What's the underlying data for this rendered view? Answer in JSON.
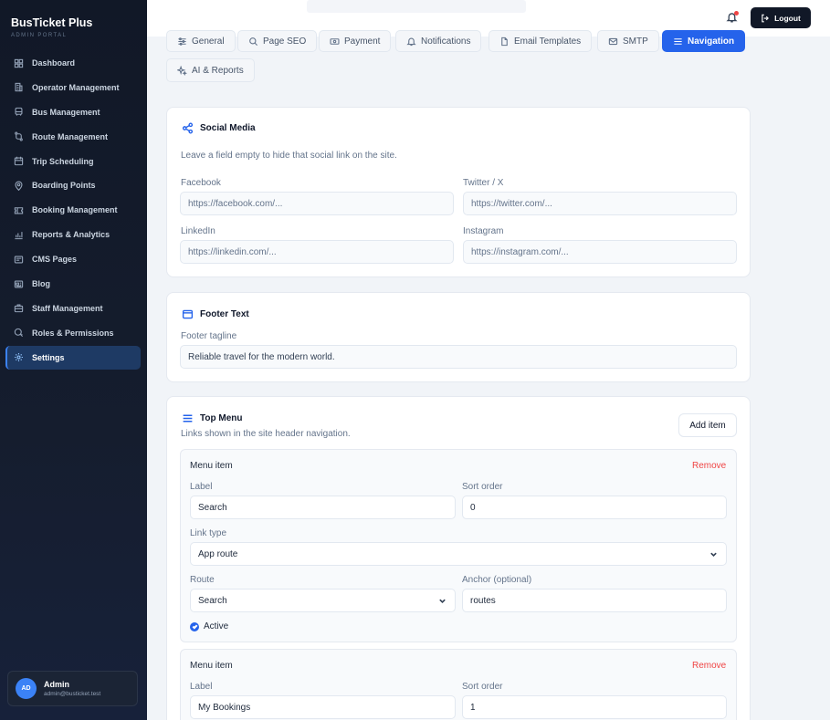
{
  "brand": {
    "title": "BusTicket Plus",
    "subtitle": "ADMIN PORTAL"
  },
  "nav": [
    {
      "label": "Dashboard",
      "icon": "dashboard-icon"
    },
    {
      "label": "Operator Management",
      "icon": "building-icon"
    },
    {
      "label": "Bus Management",
      "icon": "bus-icon"
    },
    {
      "label": "Route Management",
      "icon": "route-icon"
    },
    {
      "label": "Trip Scheduling",
      "icon": "calendar-icon"
    },
    {
      "label": "Boarding Points",
      "icon": "map-pin-icon"
    },
    {
      "label": "Booking Management",
      "icon": "ticket-icon"
    },
    {
      "label": "Reports & Analytics",
      "icon": "chart-icon"
    },
    {
      "label": "CMS Pages",
      "icon": "page-icon"
    },
    {
      "label": "Blog",
      "icon": "newspaper-icon"
    },
    {
      "label": "Staff Management",
      "icon": "briefcase-icon"
    },
    {
      "label": "Roles & Permissions",
      "icon": "shield-icon"
    },
    {
      "label": "Settings",
      "icon": "gear-icon",
      "active": true
    }
  ],
  "user": {
    "initials": "AD",
    "name": "Admin",
    "email": "admin@busticket.test"
  },
  "header": {
    "logout_label": "Logout"
  },
  "tabs": [
    {
      "label": "General",
      "icon": "sliders-icon"
    },
    {
      "label": "Page SEO",
      "icon": "search-icon"
    },
    {
      "label": "Payment",
      "icon": "money-icon"
    },
    {
      "label": "Notifications",
      "icon": "bell-icon"
    },
    {
      "label": "Email Templates",
      "icon": "file-icon"
    },
    {
      "label": "SMTP",
      "icon": "mail-icon"
    },
    {
      "label": "Navigation",
      "icon": "menu-icon",
      "active": true
    },
    {
      "label": "AI & Reports",
      "icon": "sparkle-icon"
    }
  ],
  "social": {
    "title": "Social Media",
    "hint": "Leave a field empty to hide that social link on the site.",
    "facebook": {
      "label": "Facebook",
      "placeholder": "https://facebook.com/..."
    },
    "twitter": {
      "label": "Twitter / X",
      "placeholder": "https://twitter.com/..."
    },
    "linkedin": {
      "label": "LinkedIn",
      "placeholder": "https://linkedin.com/..."
    },
    "instagram": {
      "label": "Instagram",
      "placeholder": "https://instagram.com/..."
    }
  },
  "footer": {
    "title": "Footer Text",
    "tagline_label": "Footer tagline",
    "tagline_value": "Reliable travel for the modern world."
  },
  "top_menu": {
    "title": "Top Menu",
    "hint": "Links shown in the site header navigation.",
    "add_label": "Add item",
    "items": [
      {
        "heading": "Menu item",
        "remove": "Remove",
        "label_label": "Label",
        "label_value": "Search",
        "sort_label": "Sort order",
        "sort_value": "0",
        "link_type_label": "Link type",
        "link_type_value": "App route",
        "route_label": "Route",
        "route_value": "Search",
        "anchor_label": "Anchor (optional)",
        "anchor_value": "routes",
        "active_label": "Active"
      },
      {
        "heading": "Menu item",
        "remove": "Remove",
        "label_label": "Label",
        "label_value": "My Bookings",
        "sort_label": "Sort order",
        "sort_value": "1"
      }
    ]
  }
}
